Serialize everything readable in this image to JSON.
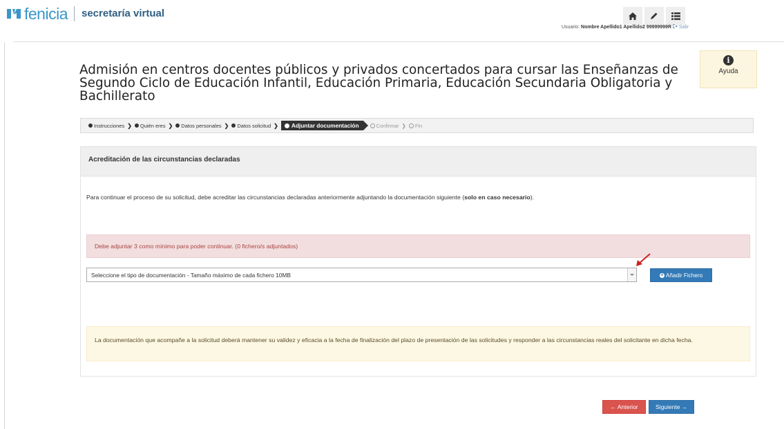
{
  "header": {
    "brand": "fenicia",
    "app_name": "secretaría virtual",
    "nav_icons": [
      "home-icon",
      "pencil-icon",
      "list-icon"
    ],
    "user_label": "Usuario:",
    "user_name": "Nombre Apellido1 Apellido2 99999999R",
    "logout": "Salir"
  },
  "page": {
    "title": "Admisión en centros docentes públicos y privados concertados para cursar las Enseñanzas de Segundo Ciclo de Educación Infantil, Educación Primaria, Educación Secundaria Obligatoria y Bachillerato",
    "help_label": "Ayuda"
  },
  "breadcrumb": {
    "steps": [
      {
        "label": "Instrucciones",
        "state": "done"
      },
      {
        "label": "Quién eres",
        "state": "done"
      },
      {
        "label": "Datos personales",
        "state": "done"
      },
      {
        "label": "Datos solicitud",
        "state": "done"
      },
      {
        "label": "Adjuntar documentación",
        "state": "active"
      },
      {
        "label": "Confirmar",
        "state": "pending"
      },
      {
        "label": "Fin",
        "state": "pending"
      }
    ]
  },
  "panel": {
    "title": "Acreditación de las circunstancias declaradas",
    "intro_prefix": "Para continuar el proceso de su solicitud, debe acreditar las circunstancias declaradas anteriormente adjuntando la documentación siguiente (",
    "intro_bold": "solo en caso necesario",
    "intro_suffix": ").",
    "error_message": "Debe adjuntar 3 como mínimo para poder continuar. (0 fichero/s adjuntados)",
    "select_value": "Seleccione el tipo de documentación - Tamaño máximo de cada fichero 10MB",
    "add_button": "Añadir Fichero",
    "warning_message": "La documentación que acompañe a la solicitud deberá mantener su validez y eficacia a la fecha de finalización del plazo de presentación de las solicitudes y responder a las circunstancias reales del solicitante en dicha fecha."
  },
  "footer": {
    "prev_button": "Anterior",
    "next_button": "Siguiente"
  },
  "colors": {
    "brand": "#3a96c9",
    "primary": "#337ab7",
    "danger": "#d9534f",
    "error_bg": "#f2dede",
    "warning_bg": "#fcf8e3",
    "annotation_arrow": "#cc2222"
  }
}
